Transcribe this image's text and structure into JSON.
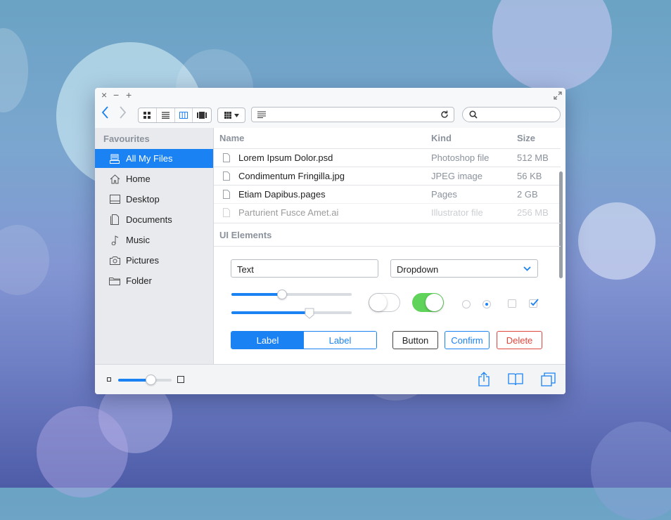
{
  "window": {
    "controls": {
      "close": "×",
      "minimize": "−",
      "zoom": "+"
    }
  },
  "toolbar": {
    "back_icon": "chevron-left-icon",
    "forward_icon": "chevron-right-icon",
    "view_modes": [
      "icon-view",
      "list-view",
      "column-view",
      "cover-flow-view"
    ],
    "active_view": "column-view",
    "address_value": "",
    "search_value": ""
  },
  "sidebar": {
    "heading": "Favourites",
    "items": [
      {
        "label": "All My Files",
        "icon": "all-files-icon",
        "active": true
      },
      {
        "label": "Home",
        "icon": "home-icon",
        "active": false
      },
      {
        "label": "Desktop",
        "icon": "desktop-icon",
        "active": false
      },
      {
        "label": "Documents",
        "icon": "documents-icon",
        "active": false
      },
      {
        "label": "Music",
        "icon": "music-icon",
        "active": false
      },
      {
        "label": "Pictures",
        "icon": "camera-icon",
        "active": false
      },
      {
        "label": "Folder",
        "icon": "folder-icon",
        "active": false
      }
    ]
  },
  "files": {
    "columns": {
      "name": "Name",
      "kind": "Kind",
      "size": "Size"
    },
    "rows": [
      {
        "name": "Lorem Ipsum Dolor.psd",
        "kind": "Photoshop file",
        "size": "512 MB"
      },
      {
        "name": "Condimentum Fringilla.jpg",
        "kind": "JPEG image",
        "size": "56 KB"
      },
      {
        "name": "Etiam Dapibus.pages",
        "kind": "Pages",
        "size": "2 GB"
      },
      {
        "name": "Parturient Fusce Amet.ai",
        "kind": "Illustrator file",
        "size": "256 MB"
      }
    ]
  },
  "ui_elements": {
    "heading": "UI Elements",
    "text_field_value": "Text",
    "dropdown_value": "Dropdown",
    "slider1_value": 0.42,
    "slider2_value": 0.65,
    "toggle_off": false,
    "toggle_on": true,
    "radio_selected": 2,
    "checkbox1_checked": false,
    "checkbox2_checked": true,
    "segment_labels": [
      "Label",
      "Label"
    ],
    "segment_selected": 0,
    "button_label": "Button",
    "confirm_label": "Confirm",
    "delete_label": "Delete"
  },
  "bottom": {
    "zoom_slider_value": 0.6,
    "icons": [
      "share-icon",
      "book-icon",
      "windows-icon"
    ]
  },
  "colors": {
    "accent": "#1a82f3",
    "toggle_green": "#5fd35a",
    "delete_red": "#e0453b"
  }
}
